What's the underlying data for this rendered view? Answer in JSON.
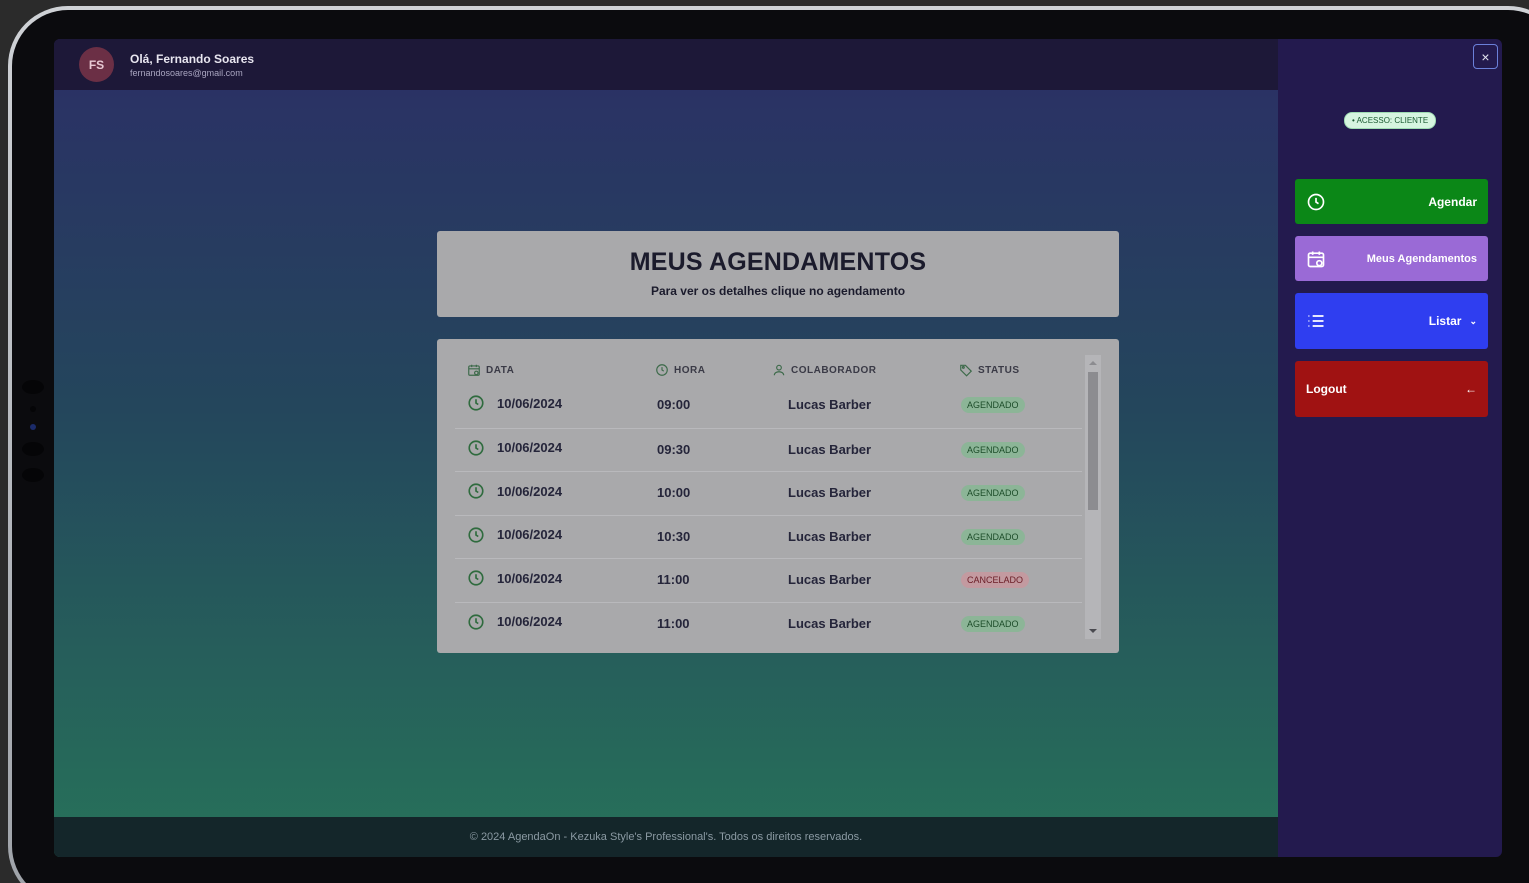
{
  "header": {
    "avatar_initials": "FS",
    "greeting": "Olá,  Fernando Soares",
    "email": "fernandosoares@gmail.com"
  },
  "page": {
    "title": "MEUS AGENDAMENTOS",
    "subtitle": "Para ver os detalhes clique no agendamento"
  },
  "table": {
    "columns": {
      "data": "DATA",
      "hora": "HORA",
      "colaborador": "COLABORADOR",
      "status": "STATUS"
    },
    "rows": [
      {
        "date": "10/06/2024",
        "time": "09:00",
        "collaborator": "Lucas Barber",
        "status": "AGENDADO",
        "status_type": "ok"
      },
      {
        "date": "10/06/2024",
        "time": "09:30",
        "collaborator": "Lucas Barber",
        "status": "AGENDADO",
        "status_type": "ok"
      },
      {
        "date": "10/06/2024",
        "time": "10:00",
        "collaborator": "Lucas Barber",
        "status": "AGENDADO",
        "status_type": "ok"
      },
      {
        "date": "10/06/2024",
        "time": "10:30",
        "collaborator": "Lucas Barber",
        "status": "AGENDADO",
        "status_type": "ok"
      },
      {
        "date": "10/06/2024",
        "time": "11:00",
        "collaborator": "Lucas Barber",
        "status": "CANCELADO",
        "status_type": "cancel"
      },
      {
        "date": "10/06/2024",
        "time": "11:00",
        "collaborator": "Lucas Barber",
        "status": "AGENDADO",
        "status_type": "ok"
      }
    ]
  },
  "footer": {
    "text": "© 2024 AgendaOn - Kezuka Style's Professional's. Todos os direitos reservados."
  },
  "sidebar": {
    "close_icon": "×",
    "access_badge": "• ACESSO: CLIENTE",
    "agendar": "Agendar",
    "meus_agendamentos": "Meus Agendamentos",
    "listar": "Listar",
    "listar_chevron": "⌄",
    "logout": "Logout",
    "logout_arrow": "←"
  },
  "colors": {
    "agendar": "#0b8717",
    "meus_agendamentos": "#9a6ad6",
    "listar": "#2f3ef0",
    "logout": "#a01212",
    "status_ok": "#8cb597",
    "status_cancel": "#c39aa0"
  }
}
